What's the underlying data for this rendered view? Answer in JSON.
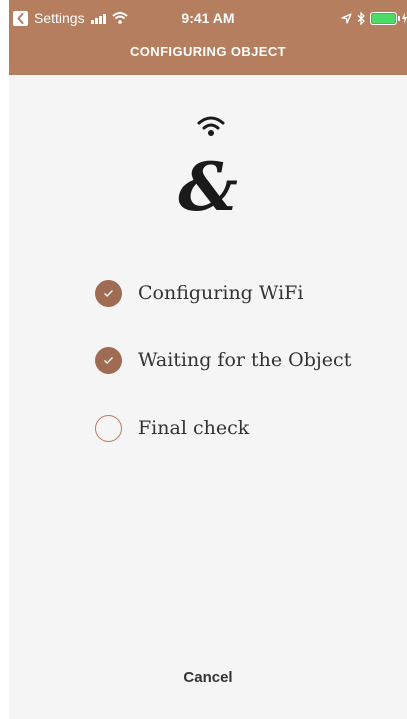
{
  "status_bar": {
    "back_app": "Settings",
    "time": "9:41 AM"
  },
  "nav": {
    "title": "CONFIGURING OBJECT"
  },
  "brand": {
    "logo_text": "&"
  },
  "steps": [
    {
      "label": "Configuring WiFi",
      "done": true
    },
    {
      "label": "Waiting for the Object",
      "done": true
    },
    {
      "label": "Final check",
      "done": false
    }
  ],
  "actions": {
    "cancel": "Cancel"
  },
  "colors": {
    "header": "#b57f5f",
    "check_done": "#9f6b52",
    "background": "#f5f5f5",
    "battery": "#4cd964"
  },
  "icons": [
    "back-chevron-icon",
    "cellular-signal-icon",
    "wifi-status-icon",
    "location-arrow-icon",
    "bluetooth-icon",
    "battery-icon",
    "charging-icon",
    "wifi-icon",
    "checkmark-icon"
  ]
}
